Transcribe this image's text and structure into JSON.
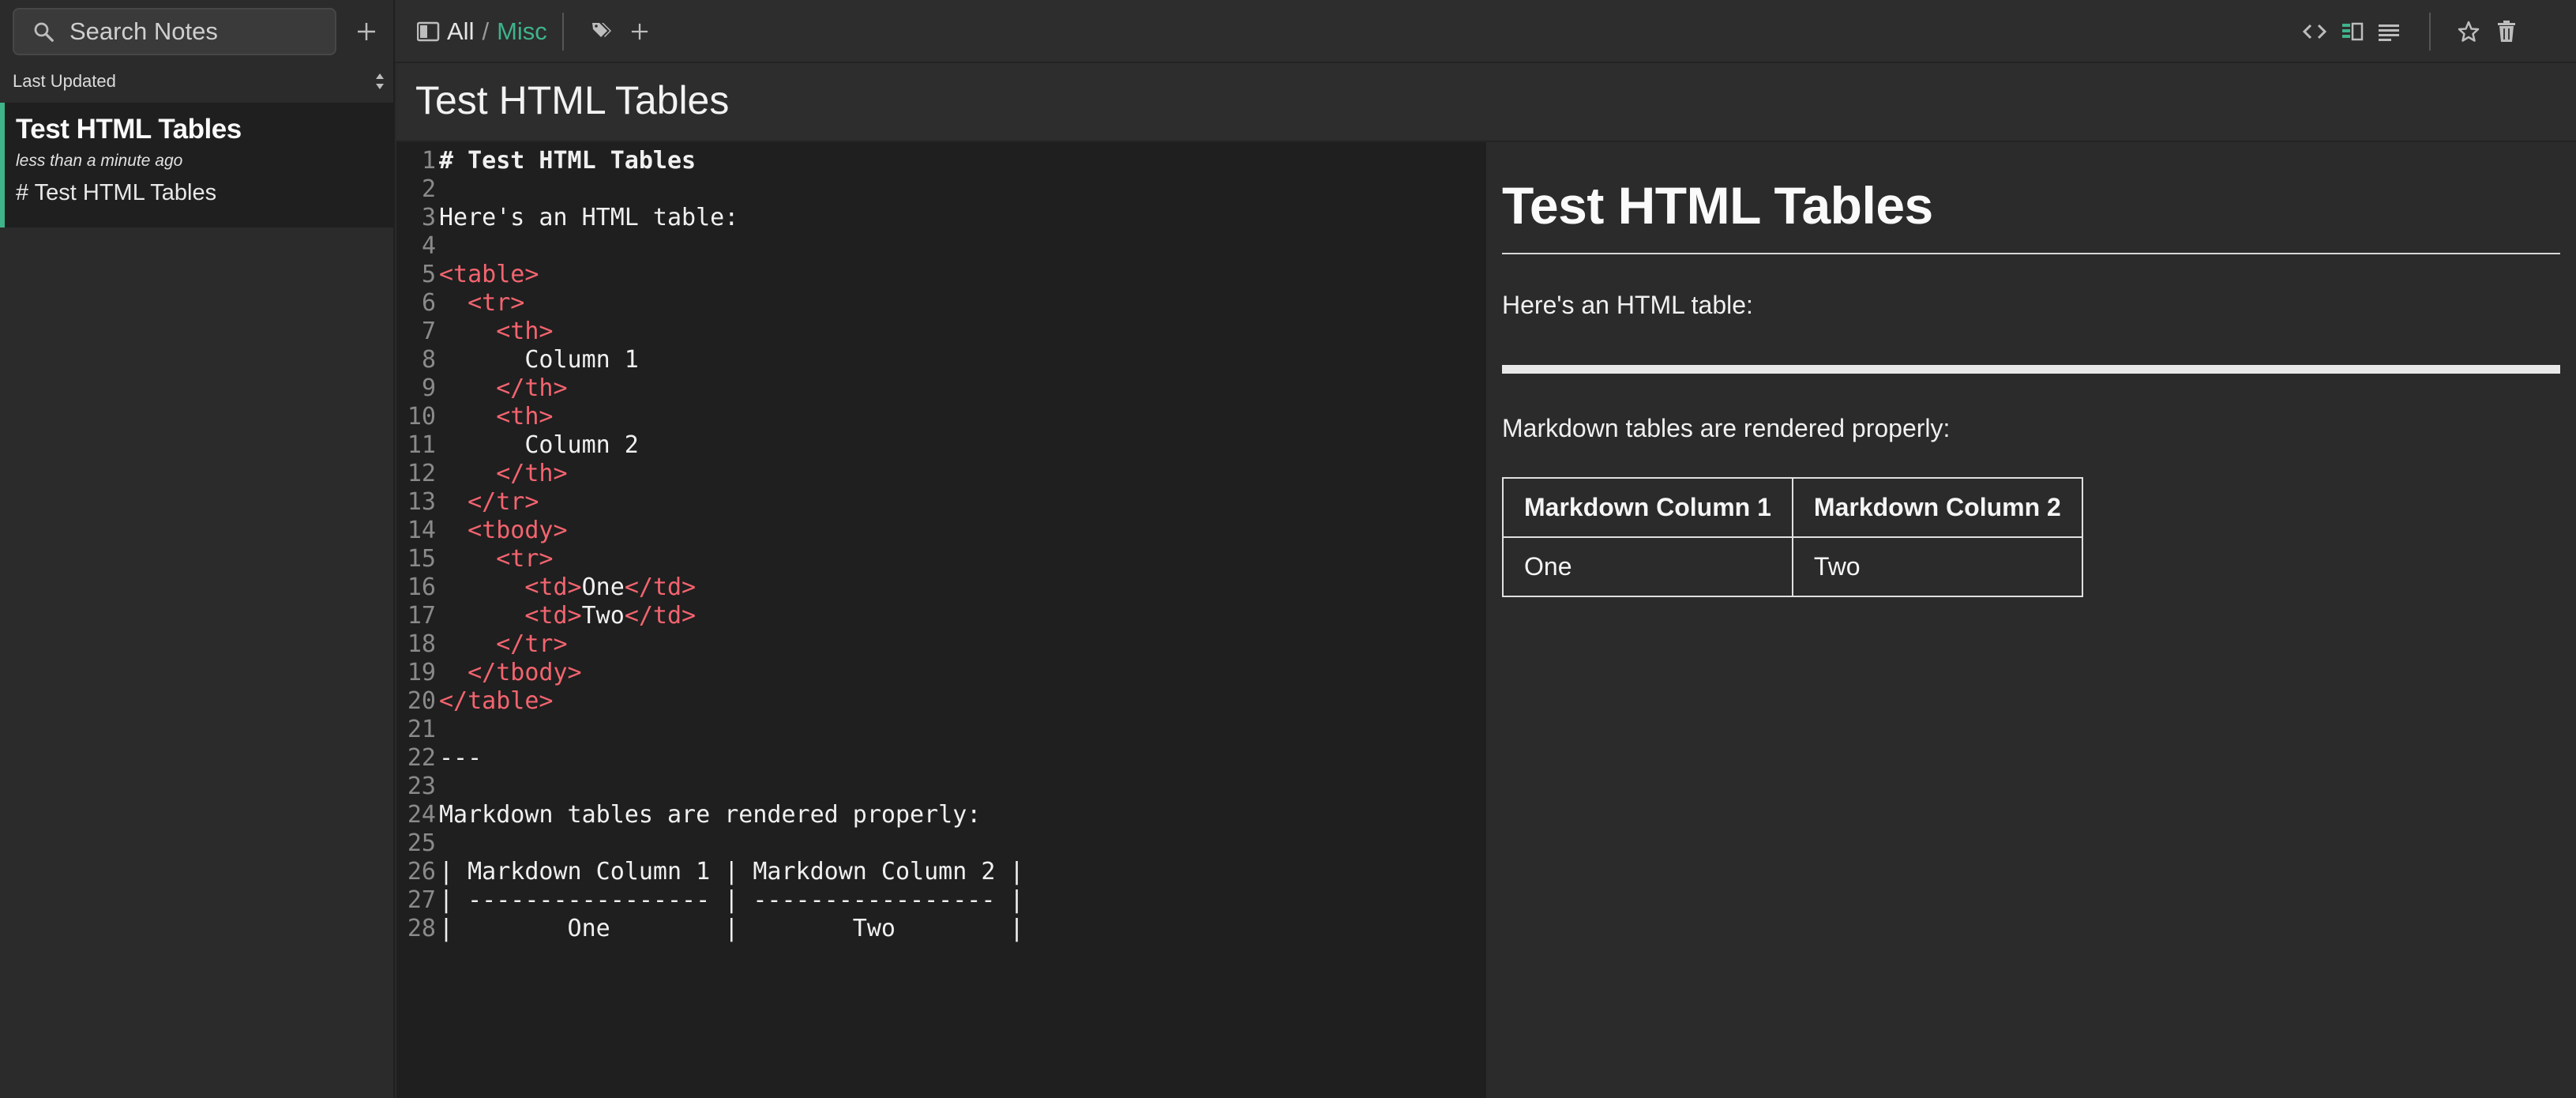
{
  "search": {
    "placeholder": "Search Notes"
  },
  "breadcrumb": {
    "all": "All",
    "separator": "/",
    "current": "Misc"
  },
  "sidebar": {
    "sort_label": "Last Updated",
    "notes": [
      {
        "title": "Test HTML Tables",
        "time": "less than a minute ago",
        "preview": "# Test HTML Tables"
      }
    ]
  },
  "note": {
    "title": "Test HTML Tables"
  },
  "editor": {
    "lines": [
      {
        "n": "1",
        "segments": [
          {
            "t": "# Test HTML Tables",
            "c": "bold"
          }
        ]
      },
      {
        "n": "2",
        "segments": []
      },
      {
        "n": "3",
        "segments": [
          {
            "t": "Here's an HTML table:",
            "c": "text"
          }
        ]
      },
      {
        "n": "4",
        "segments": []
      },
      {
        "n": "5",
        "segments": [
          {
            "t": "<table>",
            "c": "tag"
          }
        ]
      },
      {
        "n": "6",
        "segments": [
          {
            "t": "  ",
            "c": "text"
          },
          {
            "t": "<tr>",
            "c": "tag"
          }
        ]
      },
      {
        "n": "7",
        "segments": [
          {
            "t": "    ",
            "c": "text"
          },
          {
            "t": "<th>",
            "c": "tag"
          }
        ]
      },
      {
        "n": "8",
        "segments": [
          {
            "t": "      Column 1",
            "c": "text"
          }
        ]
      },
      {
        "n": "9",
        "segments": [
          {
            "t": "    ",
            "c": "text"
          },
          {
            "t": "</th>",
            "c": "tag"
          }
        ]
      },
      {
        "n": "10",
        "segments": [
          {
            "t": "    ",
            "c": "text"
          },
          {
            "t": "<th>",
            "c": "tag"
          }
        ]
      },
      {
        "n": "11",
        "segments": [
          {
            "t": "      Column 2",
            "c": "text"
          }
        ]
      },
      {
        "n": "12",
        "segments": [
          {
            "t": "    ",
            "c": "text"
          },
          {
            "t": "</th>",
            "c": "tag"
          }
        ]
      },
      {
        "n": "13",
        "segments": [
          {
            "t": "  ",
            "c": "text"
          },
          {
            "t": "</tr>",
            "c": "tag"
          }
        ]
      },
      {
        "n": "14",
        "segments": [
          {
            "t": "  ",
            "c": "text"
          },
          {
            "t": "<tbody>",
            "c": "tag"
          }
        ]
      },
      {
        "n": "15",
        "segments": [
          {
            "t": "    ",
            "c": "text"
          },
          {
            "t": "<tr>",
            "c": "tag"
          }
        ]
      },
      {
        "n": "16",
        "segments": [
          {
            "t": "      ",
            "c": "text"
          },
          {
            "t": "<td>",
            "c": "tag"
          },
          {
            "t": "One",
            "c": "text"
          },
          {
            "t": "</td>",
            "c": "tag"
          }
        ]
      },
      {
        "n": "17",
        "segments": [
          {
            "t": "      ",
            "c": "text"
          },
          {
            "t": "<td>",
            "c": "tag"
          },
          {
            "t": "Two",
            "c": "text"
          },
          {
            "t": "</td>",
            "c": "tag"
          }
        ]
      },
      {
        "n": "18",
        "segments": [
          {
            "t": "    ",
            "c": "text"
          },
          {
            "t": "</tr>",
            "c": "tag"
          }
        ]
      },
      {
        "n": "19",
        "segments": [
          {
            "t": "  ",
            "c": "text"
          },
          {
            "t": "</tbody>",
            "c": "tag"
          }
        ]
      },
      {
        "n": "20",
        "segments": [
          {
            "t": "</table>",
            "c": "tag"
          }
        ]
      },
      {
        "n": "21",
        "segments": []
      },
      {
        "n": "22",
        "segments": [
          {
            "t": "---",
            "c": "text"
          }
        ]
      },
      {
        "n": "23",
        "segments": []
      },
      {
        "n": "24",
        "segments": [
          {
            "t": "Markdown tables are rendered properly:",
            "c": "text"
          }
        ]
      },
      {
        "n": "25",
        "segments": []
      },
      {
        "n": "26",
        "segments": [
          {
            "t": "| Markdown Column 1 | Markdown Column 2 |",
            "c": "text"
          }
        ]
      },
      {
        "n": "27",
        "segments": [
          {
            "t": "| ----------------- | ----------------- |",
            "c": "text"
          }
        ]
      },
      {
        "n": "28",
        "segments": [
          {
            "t": "|        One        |        Two        |",
            "c": "text"
          }
        ]
      }
    ]
  },
  "preview": {
    "heading": "Test HTML Tables",
    "intro": "Here's an HTML table:",
    "md_intro": "Markdown tables are rendered properly:",
    "table": {
      "headers": [
        "Markdown Column 1",
        "Markdown Column 2"
      ],
      "rows": [
        [
          "One",
          "Two"
        ]
      ]
    }
  },
  "colors": {
    "accent": "#3fb389",
    "tag": "#f3646f",
    "editor_bg": "#1f1f1f",
    "preview_bg": "#2b2b2b"
  },
  "icons": [
    "search-icon",
    "plus-icon",
    "notebook-icon",
    "tags-icon",
    "code-view-icon",
    "split-view-icon",
    "preview-view-icon",
    "star-icon",
    "trash-icon",
    "sort-icon"
  ]
}
